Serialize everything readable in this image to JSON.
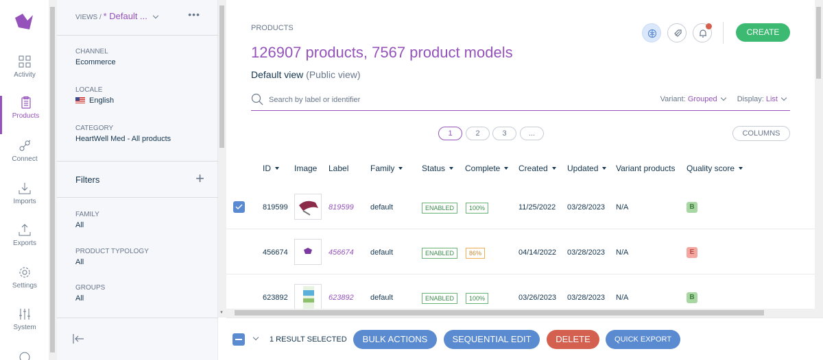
{
  "nav": {
    "items": [
      {
        "label": "Activity",
        "icon": "activity-grid-icon"
      },
      {
        "label": "Products",
        "icon": "clipboard-icon",
        "active": true
      },
      {
        "label": "Connect",
        "icon": "connect-plug-icon"
      },
      {
        "label": "Imports",
        "icon": "import-arrow-icon"
      },
      {
        "label": "Exports",
        "icon": "export-arrow-icon"
      },
      {
        "label": "Settings",
        "icon": "gear-icon"
      },
      {
        "label": "System",
        "icon": "sliders-icon"
      }
    ]
  },
  "panel": {
    "views_prefix": "VIEWS /",
    "current_view": "* Default ...",
    "channel": {
      "label": "CHANNEL",
      "value": "Ecommerce"
    },
    "locale": {
      "label": "LOCALE",
      "value": "English"
    },
    "category": {
      "label": "CATEGORY",
      "value": "HeartWell Med - All products"
    },
    "filters_title": "Filters",
    "filters": [
      {
        "label": "FAMILY",
        "value": "All"
      },
      {
        "label": "PRODUCT TYPOLOGY",
        "value": "All"
      },
      {
        "label": "GROUPS",
        "value": "All"
      }
    ]
  },
  "header": {
    "breadcrumb": "PRODUCTS",
    "title": "126907 products, 7567 product models",
    "view_name": "Default view",
    "view_scope": "(Public view)",
    "create_label": "CREATE"
  },
  "search": {
    "placeholder": "Search by label or identifier",
    "variant_label": "Variant:",
    "variant_value": "Grouped",
    "display_label": "Display:",
    "display_value": "List"
  },
  "pagination": {
    "pages": [
      "1",
      "2",
      "3",
      "..."
    ],
    "current": "1"
  },
  "columns_button": "COLUMNS",
  "table": {
    "headers": [
      "ID",
      "Image",
      "Label",
      "Family",
      "Status",
      "Complete",
      "Created",
      "Updated",
      "Variant products",
      "Quality score"
    ],
    "rows": [
      {
        "id": "819599",
        "label": "819599",
        "family": "default",
        "status": "ENABLED",
        "complete": "100%",
        "created": "11/25/2022",
        "updated": "03/28/2023",
        "variant": "N/A",
        "quality": "B",
        "selected": true
      },
      {
        "id": "456674",
        "label": "456674",
        "family": "default",
        "status": "ENABLED",
        "complete": "86%",
        "created": "04/14/2022",
        "updated": "03/28/2023",
        "variant": "N/A",
        "quality": "E",
        "selected": false
      },
      {
        "id": "623892",
        "label": "623892",
        "family": "default",
        "status": "ENABLED",
        "complete": "100%",
        "created": "03/26/2023",
        "updated": "03/28/2023",
        "variant": "N/A",
        "quality": "B",
        "selected": false
      }
    ]
  },
  "footer": {
    "selected_count": "1 RESULT SELECTED",
    "bulk_actions": "BULK ACTIONS",
    "sequential_edit": "SEQUENTIAL EDIT",
    "delete": "DELETE",
    "quick_export": "QUICK EXPORT"
  },
  "colors": {
    "brand": "#9452ba",
    "create": "#3cba72",
    "action": "#5a8ad0",
    "danger": "#d4604f"
  }
}
